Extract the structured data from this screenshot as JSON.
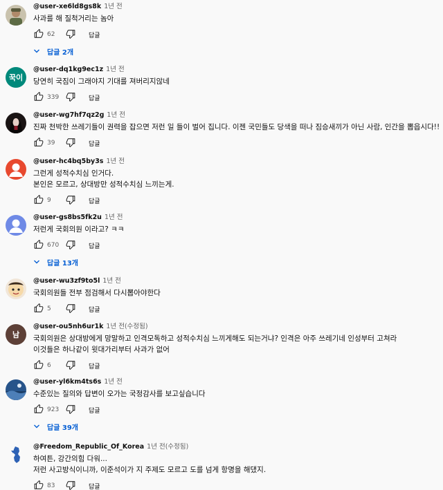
{
  "colors": {
    "link": "#065fd4",
    "meta": "#606060",
    "text": "#0f0f0f"
  },
  "comments": [
    {
      "user": "@user-xe6ld8gs8k",
      "time": "1년 전",
      "edited": "",
      "lines": [
        "사과를 해 질척거리는 놈아"
      ],
      "likes": "62",
      "reply_label": "답글",
      "replies": "답글 2개",
      "avatar": {
        "type": "image",
        "desc": "soldier"
      }
    },
    {
      "user": "@user-dq1kg9ec1z",
      "time": "1년 전",
      "edited": "",
      "lines": [
        "당연히 국짐이 그래야지 기대를 져버리지않네"
      ],
      "likes": "339",
      "reply_label": "답글",
      "replies": "",
      "avatar": {
        "type": "text",
        "text": "꾹이",
        "color": "#00897b"
      }
    },
    {
      "user": "@user-wg7hf7qz2g",
      "time": "1년 전",
      "edited": "",
      "lines": [
        "진짜 천박한 쓰레기들이 권력을 잡으면 저런 일 들이 벌어 집니다. 이젠 국민들도 당색을 떠나 짐승새끼가 아닌 사람, 인간을 뽑읍시다!!"
      ],
      "likes": "39",
      "reply_label": "답글",
      "replies": "",
      "avatar": {
        "type": "image",
        "desc": "woman-portrait"
      }
    },
    {
      "user": "@user-hc4bq5by3s",
      "time": "1년 전",
      "edited": "",
      "lines": [
        "그런게 성적수치심 인거다.",
        "본인은 모르고, 상대방만 성적수치심 느끼는게."
      ],
      "likes": "9",
      "reply_label": "답글",
      "replies": "",
      "avatar": {
        "type": "default",
        "color": "#e8492f"
      }
    },
    {
      "user": "@user-gs8bs5fk2u",
      "time": "1년 전",
      "edited": "",
      "lines": [
        "저런게 국회의원 이라고? ㅋㅋ"
      ],
      "likes": "670",
      "reply_label": "답글",
      "replies": "답글 13개",
      "avatar": {
        "type": "default",
        "color": "#6f8ae6"
      }
    },
    {
      "user": "@user-wu3zf9to5l",
      "time": "1년 전",
      "edited": "",
      "lines": [
        "국회의원들 전부 점검해서 다시뽑아야한다"
      ],
      "likes": "5",
      "reply_label": "답글",
      "replies": "",
      "avatar": {
        "type": "image",
        "desc": "emoji-face"
      }
    },
    {
      "user": "@user-ou5nh6ur1k",
      "time": "1년 전",
      "edited": "(수정됨)",
      "lines": [
        "국회의원은 상대방에게 망말하고 인격모독하고 성적수치심 느끼게해도 되는거냐? 인격은 아주 쓰레기네 인성부터 고쳐라",
        "이것들은 하나같이 윗대가리부터 사과가 없어"
      ],
      "likes": "6",
      "reply_label": "답글",
      "replies": "",
      "avatar": {
        "type": "text",
        "text": "남",
        "color": "#5d4037"
      }
    },
    {
      "user": "@user-yl6km4ts6s",
      "time": "1년 전",
      "edited": "",
      "lines": [
        "수준있는 질의와 답변이 오가는 국정감사를 보고싶습니다"
      ],
      "likes": "923",
      "reply_label": "답글",
      "replies": "답글 39개",
      "avatar": {
        "type": "image",
        "desc": "blue-landscape"
      }
    },
    {
      "user": "@Freedom_Republic_Of_Korea",
      "time": "1년 전",
      "edited": "(수정됨)",
      "lines": [
        "하여튼, 강간의힘 다워...",
        "저런 사고방식이니까, 이준석이가 지 주제도 모르고 도를 넘게 항명을 해댔지."
      ],
      "likes": "83",
      "reply_label": "답글",
      "replies": "",
      "avatar": {
        "type": "image",
        "desc": "korea-map"
      }
    }
  ]
}
